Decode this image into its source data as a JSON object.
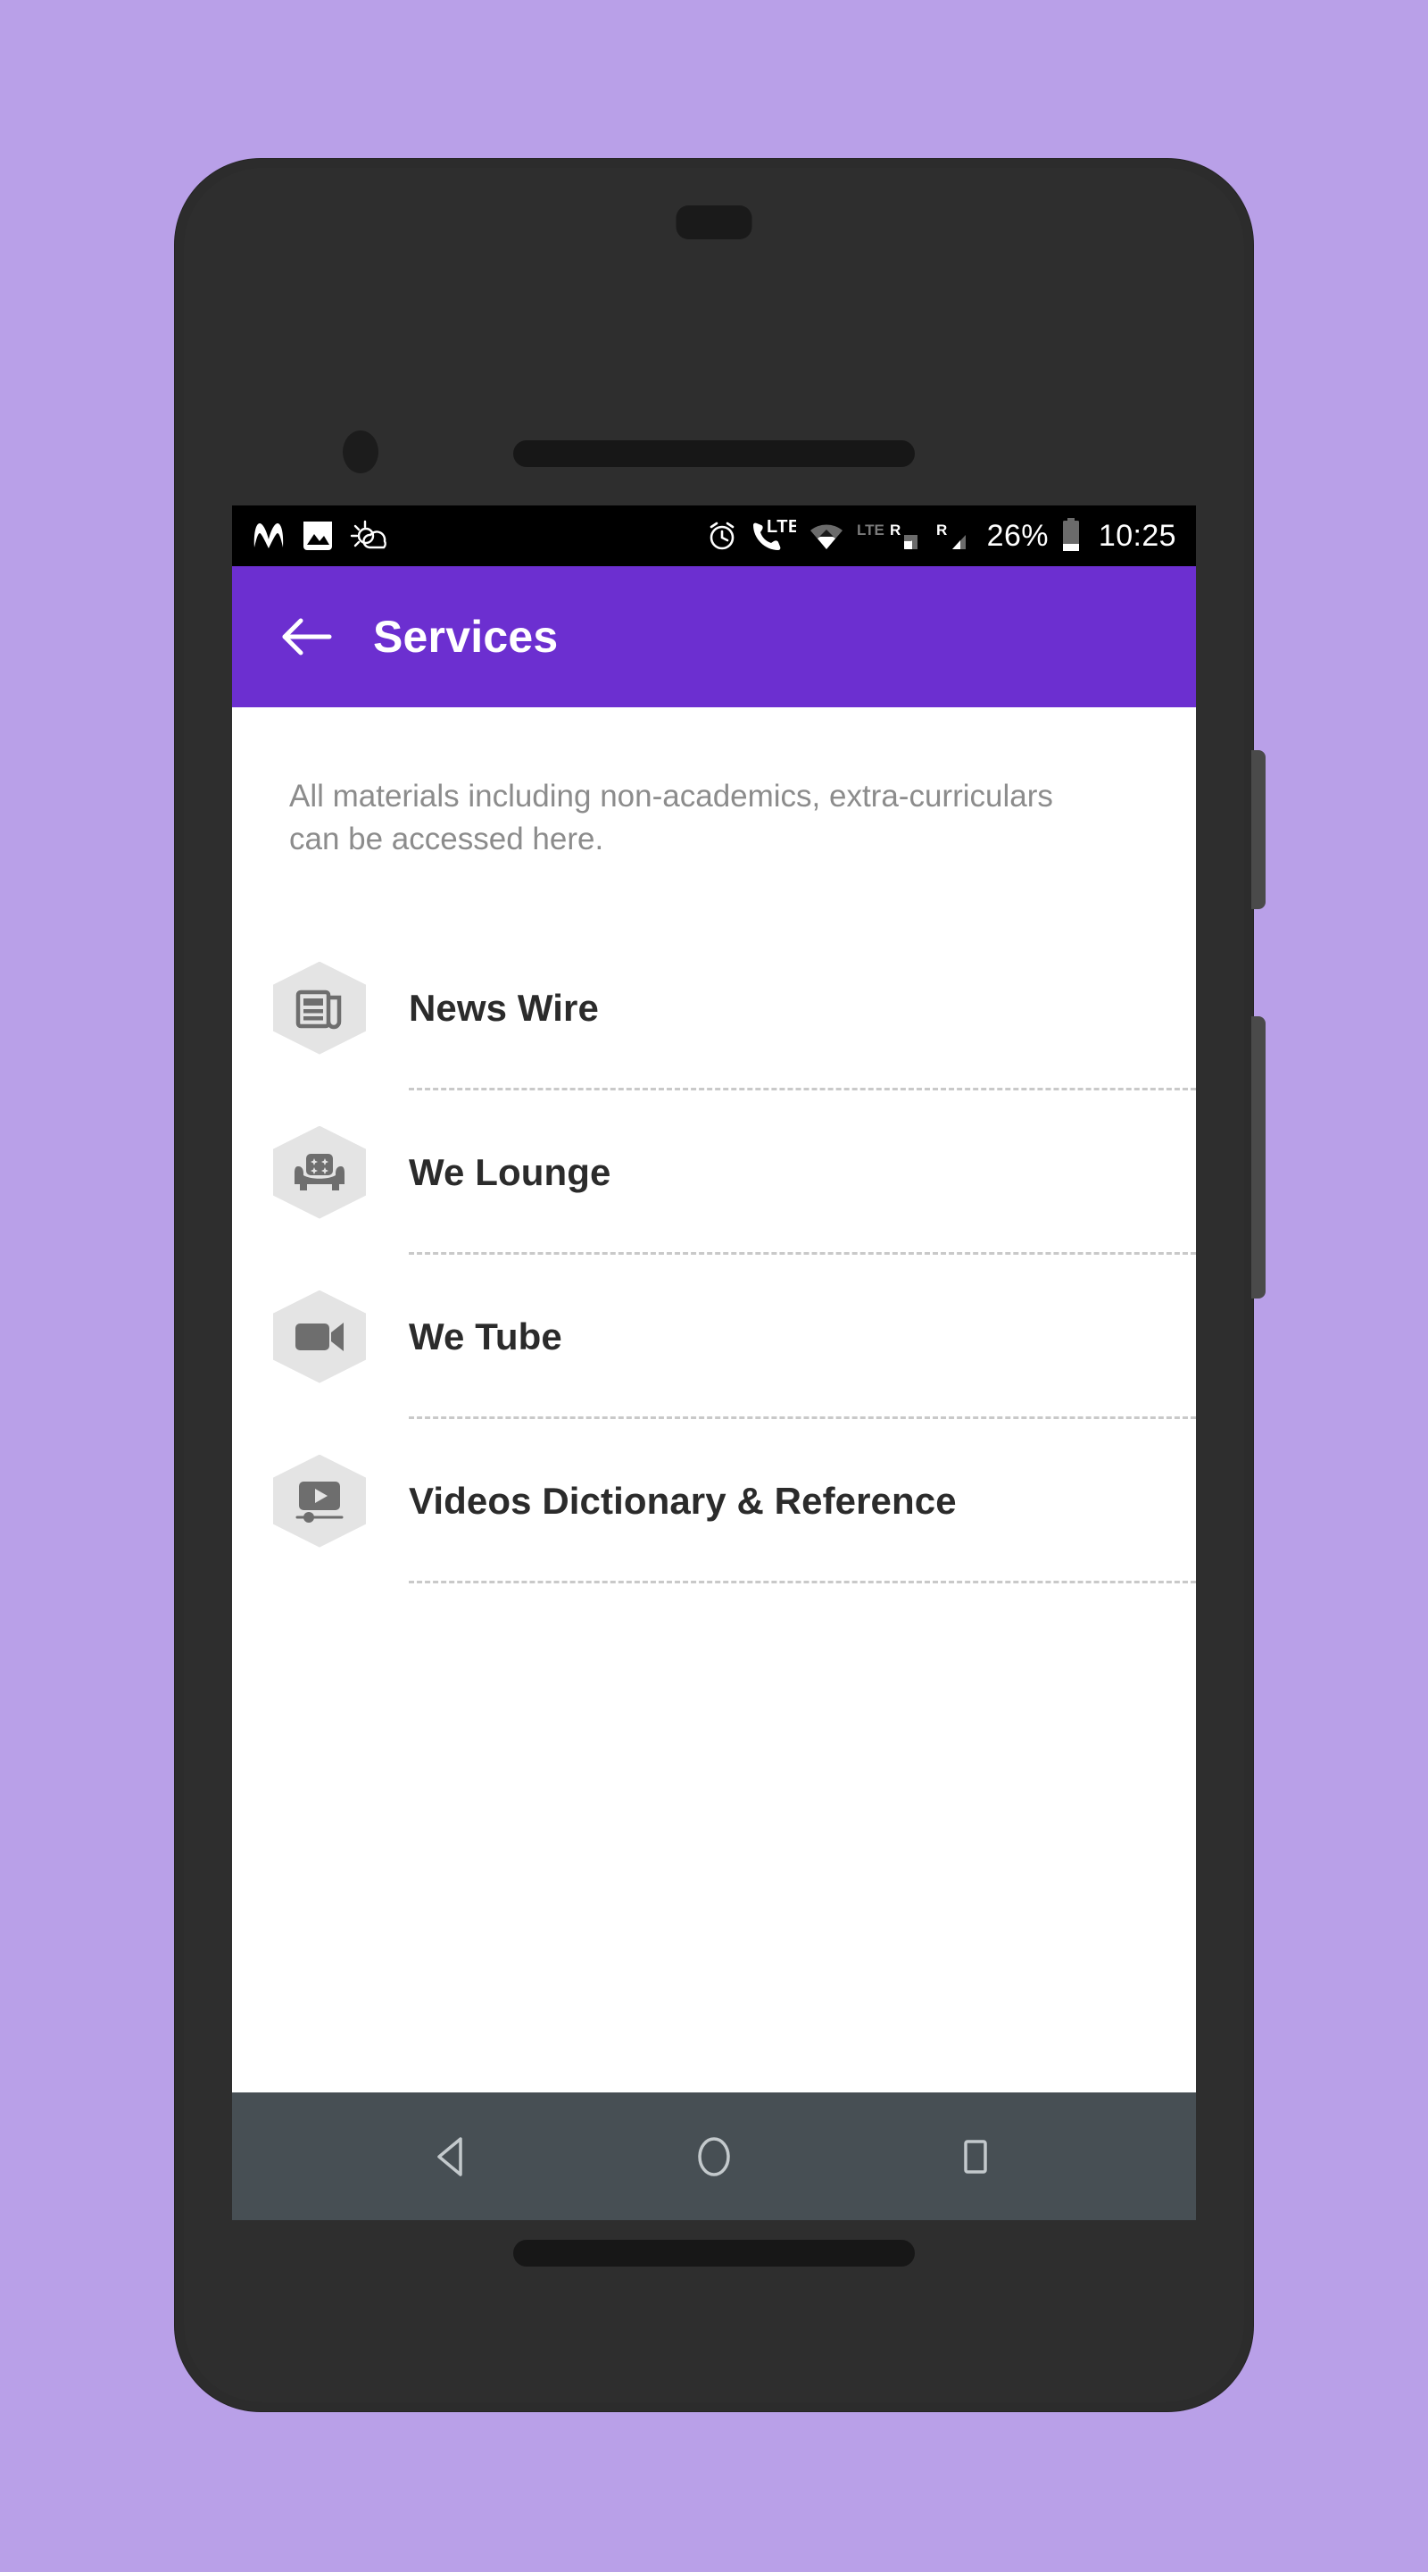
{
  "theme": {
    "page_background": "#b9a0e8",
    "app_bar_color": "#6c2fd0",
    "device_frame_color": "#2c2c2c",
    "nav_bar_color": "#474f54",
    "icon_hex_color": "#e4e4e4",
    "icon_glyph_color": "#6e6e6e",
    "description_text_color": "#8c8c8c",
    "list_label_color": "#2b2b2b",
    "divider_color": "#c9c9c9"
  },
  "status_bar": {
    "left_icons": [
      {
        "name": "m-logo-icon",
        "label": "M"
      },
      {
        "name": "gallery-image-icon",
        "label": "Image"
      },
      {
        "name": "weather-sun-cloud-icon",
        "label": "Weather"
      }
    ],
    "right_icons": [
      {
        "name": "alarm-clock-icon",
        "label": "Alarm"
      },
      {
        "name": "volte-call-icon",
        "label": "LTE"
      },
      {
        "name": "wifi-icon",
        "label": "Wi-Fi"
      },
      {
        "name": "lte-roaming-signal-icon",
        "label": "LTE R"
      },
      {
        "name": "roaming-signal-icon",
        "label": "R"
      }
    ],
    "battery_percent": "26%",
    "clock": "10:25",
    "lte_label": "LTE",
    "roaming_label": "R"
  },
  "app_bar": {
    "back_label": "Back",
    "title": "Services"
  },
  "content": {
    "description": "All materials including non-academics, extra-curriculars can be accessed here.",
    "services": [
      {
        "label": "News Wire",
        "icon": "newspaper-icon"
      },
      {
        "label": "We Lounge",
        "icon": "armchair-icon"
      },
      {
        "label": "We Tube",
        "icon": "video-camera-icon"
      },
      {
        "label": "Videos Dictionary & Reference",
        "icon": "video-player-icon"
      }
    ]
  },
  "nav_bar": {
    "buttons": [
      {
        "name": "nav-back-button",
        "label": "Back"
      },
      {
        "name": "nav-home-button",
        "label": "Home"
      },
      {
        "name": "nav-recents-button",
        "label": "Recents"
      }
    ]
  }
}
